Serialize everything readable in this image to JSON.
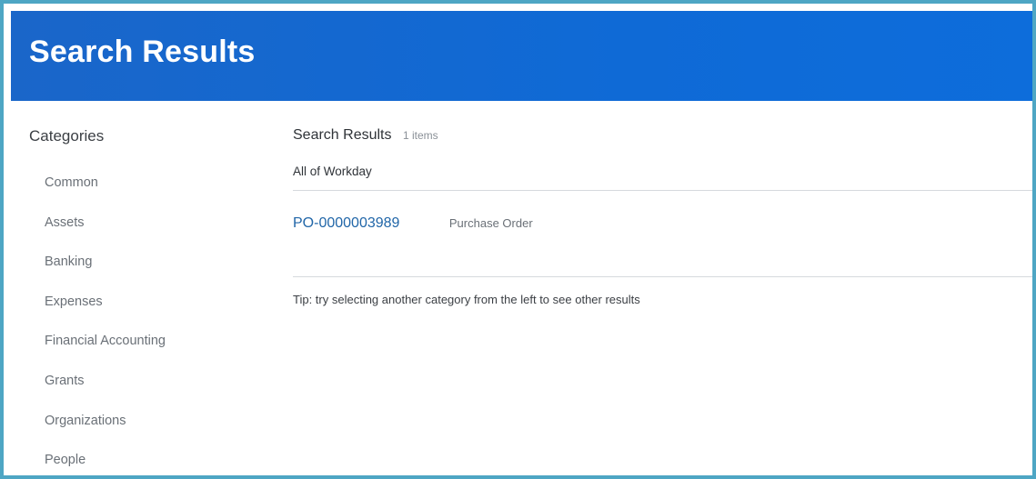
{
  "header": {
    "title": "Search Results",
    "color": "#0d6ddb"
  },
  "sidebar": {
    "heading": "Categories",
    "items": [
      {
        "label": "Common"
      },
      {
        "label": "Assets"
      },
      {
        "label": "Banking"
      },
      {
        "label": "Expenses"
      },
      {
        "label": "Financial Accounting"
      },
      {
        "label": "Grants"
      },
      {
        "label": "Organizations"
      },
      {
        "label": "People"
      }
    ]
  },
  "main": {
    "title": "Search Results",
    "count": "1 items",
    "scope": "All of Workday",
    "results": [
      {
        "id": "PO-0000003989",
        "type": "Purchase Order",
        "link_color": "#2166a8"
      }
    ],
    "tip": "Tip: try selecting another category from the left to see other results"
  },
  "frame": {
    "border_color": "#4ea6c4"
  }
}
